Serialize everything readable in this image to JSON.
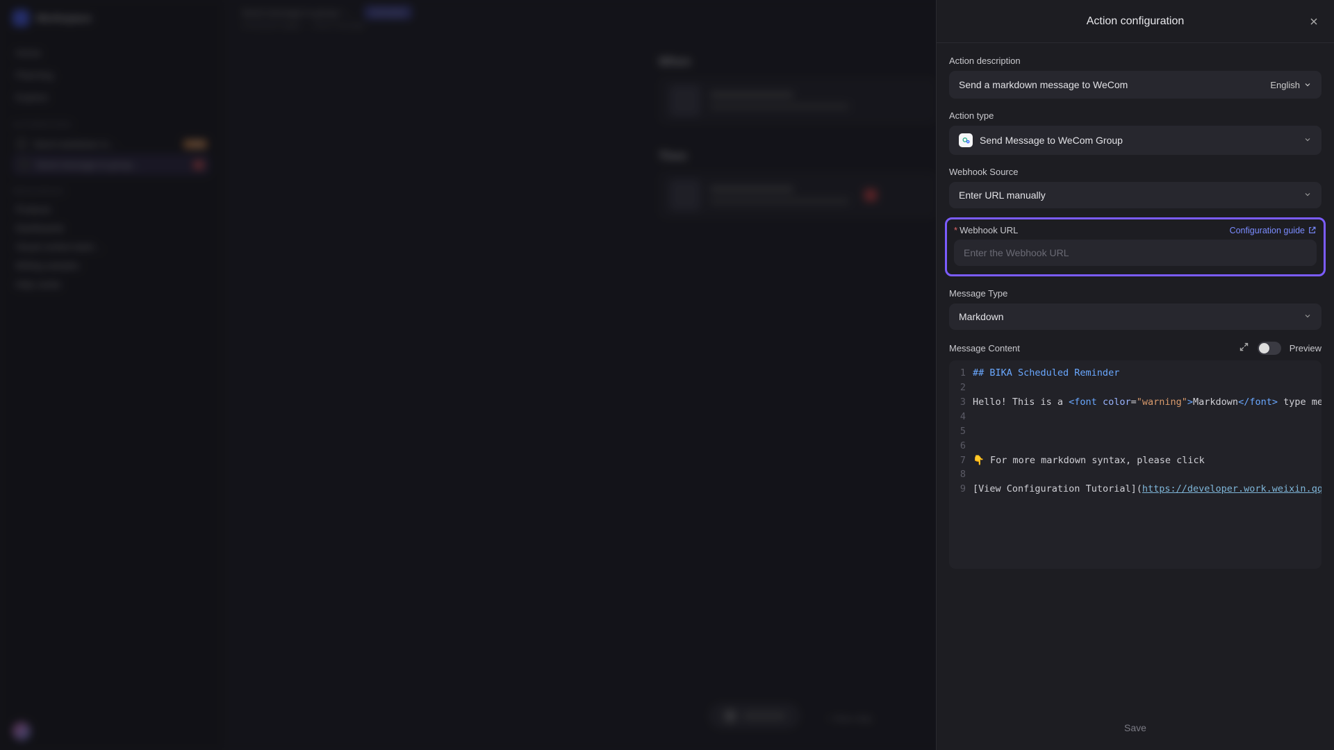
{
  "panel": {
    "title": "Action configuration",
    "desc_label": "Action description",
    "desc_value": "Send a markdown message to WeCom",
    "lang": "English",
    "type_label": "Action type",
    "type_value": "Send Message to WeCom Group",
    "source_label": "Webhook Source",
    "source_value": "Enter URL manually",
    "url_label": "Webhook URL",
    "url_placeholder": "Enter the Webhook URL",
    "cfg_link": "Configuration guide",
    "msgtype_label": "Message Type",
    "msgtype_value": "Markdown",
    "content_label": "Message Content",
    "preview_label": "Preview",
    "save_label": "Save"
  },
  "code": {
    "l1_head": "## BIKA Scheduled Reminder",
    "l3_a": "Hello! This is a ",
    "l3_tag_open": "<font",
    "l3_attr": " color",
    "l3_eq": "=",
    "l3_str": "\"warning\"",
    "l3_close": ">",
    "l3_mid": "Markdown",
    "l3_tag_end": "</font>",
    "l3_b": " type message",
    "l7_emoji": "👇",
    "l7_rest": " For more markdown syntax, please click",
    "l9_a": "[",
    "l9_txt": "View Configuration Tutorial",
    "l9_b": "](",
    "l9_url": "https://developer.work.weixin.qq.com"
  },
  "bg": {
    "workspace": "Workspace",
    "nav1": "Home",
    "nav2": "Planning",
    "nav3": "Explore",
    "hdr_auto": "AUTOMATIONS",
    "auto1": "Send markdown m…",
    "auto1_badge": "1 day",
    "auto2": "Send message to group…",
    "auto2_badge": "1",
    "hdr_res": "RESOURCES",
    "res1": "Products",
    "res2": "Dashboards",
    "res3": "Visual content dash…",
    "res4": "Writing samples",
    "res5": "Help center",
    "crumb": "Send message to group / …",
    "chip": "Activated",
    "sub": "Scheduled trigger → Send message",
    "sect_when": "When",
    "sect_then": "Then",
    "newstep": "+ New step"
  }
}
